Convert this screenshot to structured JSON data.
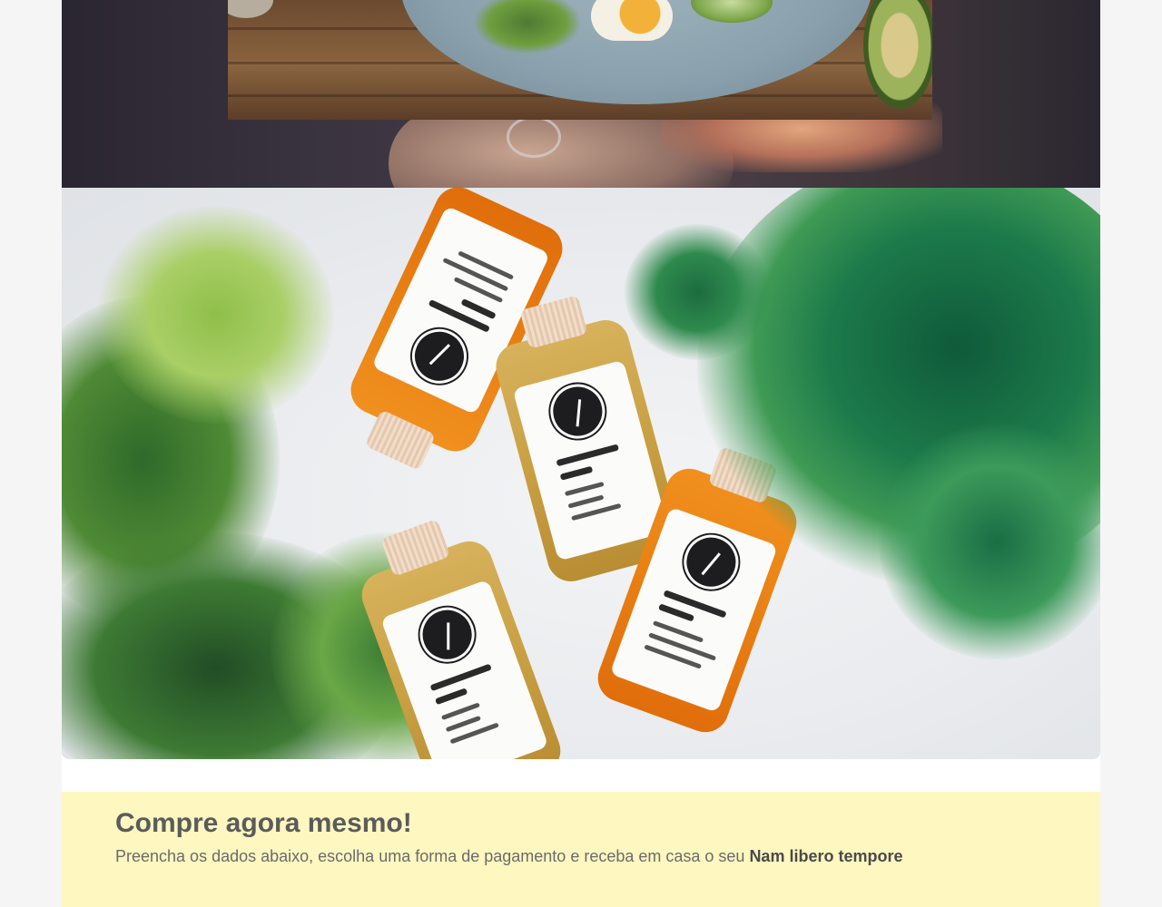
{
  "hero_top": {
    "description_alt": ""
  },
  "cta": {
    "title": "Compre agora mesmo!",
    "text": "Preencha os dados abaixo, escolha uma forma de pagamento e receba em casa o seu ",
    "product_name": "Nam libero tempore"
  },
  "colors": {
    "page_background": "#f5f5f5",
    "cta_background": "#fef7c0",
    "title_color": "#5b5b5b",
    "text_color": "#6b6b6b"
  }
}
